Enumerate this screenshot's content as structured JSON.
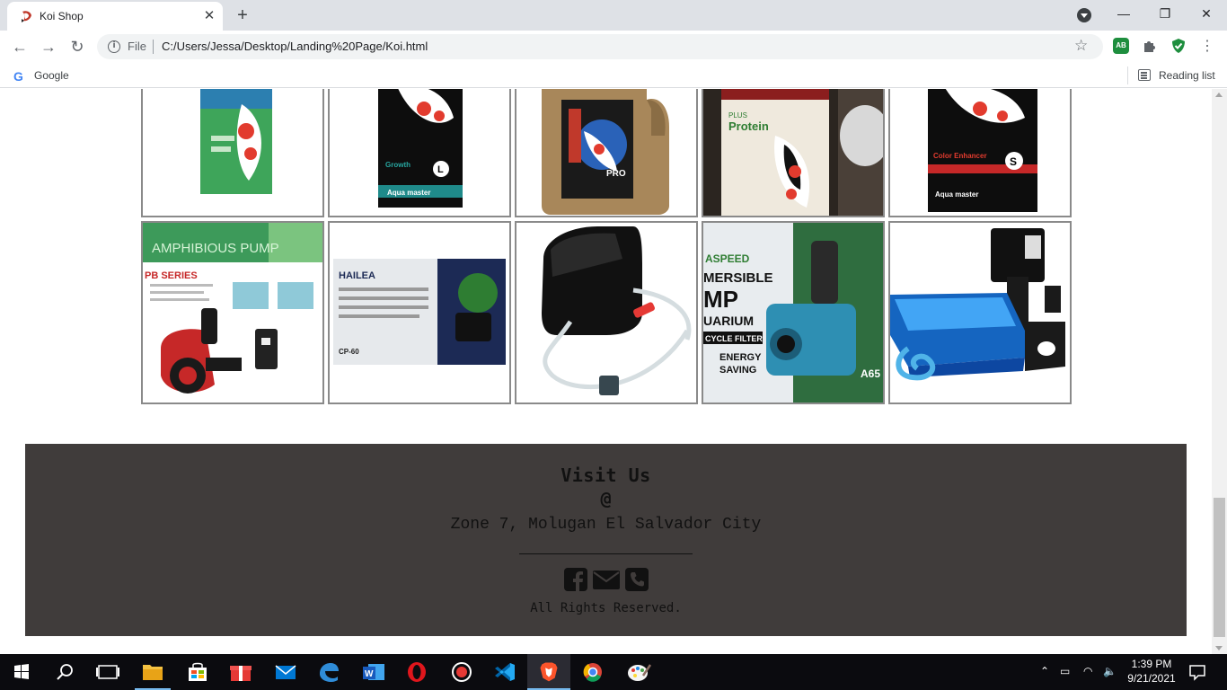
{
  "browser": {
    "tab_title": "Koi Shop",
    "new_tab": "+",
    "address_label": "File",
    "url": "C:/Users/Jessa/Desktop/Landing%20Page/Koi.html",
    "bookmark_google": "Google",
    "reading_list": "Reading list",
    "ext_adblock": "AB",
    "window_controls": [
      "minimize",
      "restore",
      "close"
    ]
  },
  "products_row1": [
    {
      "icon": "koi-food-bag-green"
    },
    {
      "icon": "koi-food-growth-bag"
    },
    {
      "icon": "koi-pellet-jug"
    },
    {
      "icon": "koi-protein-tub"
    },
    {
      "icon": "koi-color-enhancer-bag"
    }
  ],
  "products_row2": [
    {
      "icon": "amphibious-pump"
    },
    {
      "icon": "hailea-air-pump-box"
    },
    {
      "icon": "air-pump-with-airstone"
    },
    {
      "icon": "submersible-pump-box"
    },
    {
      "icon": "filter-box-pump"
    }
  ],
  "product_images": {
    "hailea_brand": "HAILEA",
    "hailea_model": "CP-60",
    "pump_series": "PB SERIES",
    "pump_banner": "AMPHIBIOUS PUMP",
    "sub_pump_text": "MERSIBLE",
    "sub_pump_text2": "MP",
    "sub_pump_text3": "UARIUM",
    "sub_pump_text4": "CYCLE FILTER",
    "sub_pump_energy": "ENERGY",
    "sub_pump_saving": "SAVING",
    "sub_pump_brand": "ASPEED",
    "sub_pump_model": "A65",
    "bag_brand": "Aqua master",
    "bag_growth": "Growth",
    "bag_growth_size": "L",
    "bag_color": "Color Enhancer",
    "bag_color_size": "S",
    "jug_label": "PRO",
    "tub_label": "Protein"
  },
  "footer": {
    "title": "Visit Us",
    "at": "@",
    "address": "Zone 7, Molugan El Salvador City",
    "copyright": "All Rights Reserved.",
    "social": [
      "facebook-icon",
      "mail-icon",
      "phone-icon"
    ]
  },
  "taskbar": {
    "apps": [
      "file-explorer",
      "store",
      "gift",
      "mail",
      "edge",
      "word",
      "opera",
      "recorder",
      "vscode",
      "brave",
      "chrome",
      "paint"
    ],
    "time": "1:39 PM",
    "date": "9/21/2021"
  },
  "colors": {
    "footer_bg": "#403c3b",
    "border": "#8a8a8a",
    "taskbar": "#0b0b0f"
  }
}
